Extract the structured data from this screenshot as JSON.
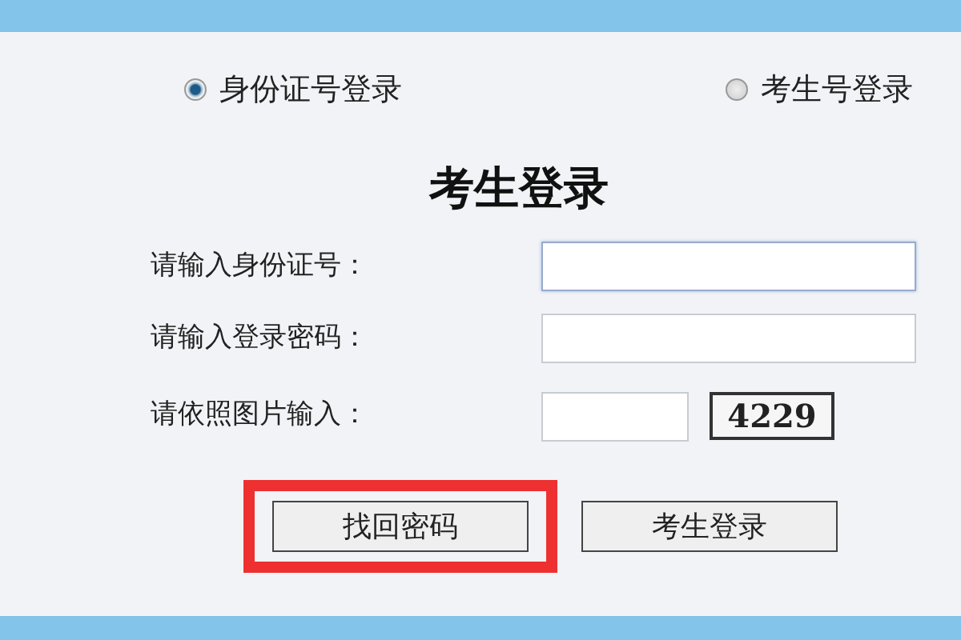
{
  "login_modes": [
    {
      "label": "身份证号登录",
      "selected": true
    },
    {
      "label": "考生号登录",
      "selected": false
    }
  ],
  "title": "考生登录",
  "fields": [
    {
      "label": "请输入身份证号：",
      "kind": "text",
      "focused": true
    },
    {
      "label": "请输入登录密码：",
      "kind": "password",
      "focused": false
    },
    {
      "label": "请依照图片输入：",
      "kind": "captcha",
      "focused": false,
      "captcha": "4229"
    }
  ],
  "buttons": [
    {
      "label": "找回密码",
      "highlighted": true
    },
    {
      "label": "考生登录",
      "highlighted": false
    }
  ]
}
